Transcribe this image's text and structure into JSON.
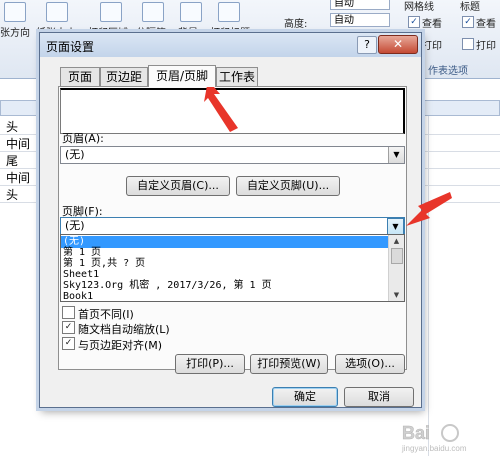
{
  "ribbon": {
    "zhang_fangxiang": "张方向",
    "zhizhang_daxiao": "纸张大小",
    "dayin_quyu": "打印区域",
    "fenge_fu": "分隔符",
    "beijing": "背景",
    "dayin_biaoti": "打印标题",
    "gaodu_label": "高度:",
    "gaodu_value": "自动",
    "kuandu_value": "自动",
    "wanggexian": "网格线",
    "biaoti": "标题",
    "chakan_1": "查看",
    "chakan_2": "查看",
    "dayin_1": "打印",
    "dayin_2": "打印",
    "gongzuobiao_xuanxiang": "作表选项"
  },
  "sheet": {
    "column_c": "C",
    "cells": [
      "头",
      "中间",
      "尾",
      "中间",
      "头"
    ]
  },
  "dialog": {
    "title": "页面设置",
    "help": "?",
    "close": "✕",
    "tabs": [
      "页面",
      "页边距",
      "页眉/页脚",
      "工作表"
    ],
    "header_label": "页眉(A):",
    "header_value": "(无)",
    "custom_header_btn": "自定义页眉(C)...",
    "custom_footer_btn": "自定义页脚(U)...",
    "footer_label": "页脚(F):",
    "footer_value": "(无)",
    "footer_options": [
      "(无)",
      "第 1 页",
      "第 1 页,共 ? 页",
      "Sheet1",
      "Sky123.Org 机密 , 2017/3/26,  第 1 页",
      "Book1"
    ],
    "checkboxes": [
      {
        "label": "首页不同(I)",
        "checked": false
      },
      {
        "label": "随文档自动缩放(L)",
        "checked": true
      },
      {
        "label": "与页边距对齐(M)",
        "checked": true
      }
    ],
    "print_btn": "打印(P)...",
    "preview_btn": "打印预览(W)",
    "options_btn": "选项(O)...",
    "ok_btn": "确定",
    "cancel_btn": "取消"
  },
  "watermark": {
    "text": "Bai",
    "sub": "jingyan.baidu.com"
  },
  "colors": {
    "selection": "#3399ff",
    "arrow": "#e8352a"
  }
}
